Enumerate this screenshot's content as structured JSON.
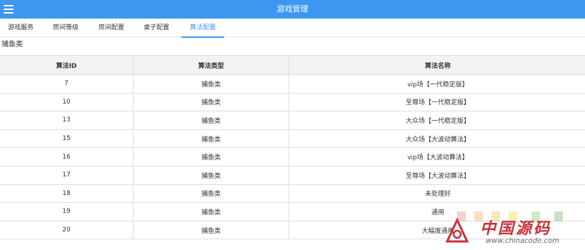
{
  "header": {
    "title": "游戏管理",
    "menu_icon": "hamburger-menu-icon",
    "background": "#3d97f0"
  },
  "tabs": [
    {
      "label": "游戏服务",
      "active": false
    },
    {
      "label": "房间等级",
      "active": false
    },
    {
      "label": "房间配置",
      "active": false
    },
    {
      "label": "桌子配置",
      "active": false
    },
    {
      "label": "算法配置",
      "active": true
    }
  ],
  "category_label": "捕鱼类",
  "table": {
    "columns": [
      "算法ID",
      "算法类型",
      "算法名称"
    ],
    "rows": [
      [
        "7",
        "捕鱼类",
        "vip场【一代稳定版】"
      ],
      [
        "10",
        "捕鱼类",
        "至尊场【一代稳定版】"
      ],
      [
        "13",
        "捕鱼类",
        "大众场【一代稳定版】"
      ],
      [
        "15",
        "捕鱼类",
        "大众场【大波动算法】"
      ],
      [
        "16",
        "捕鱼类",
        "vip场【大波动算法】"
      ],
      [
        "17",
        "捕鱼类",
        "至尊场【大波动算法】"
      ],
      [
        "18",
        "捕鱼类",
        "未处理好"
      ],
      [
        "19",
        "捕鱼类",
        "通用"
      ],
      [
        "20",
        "捕鱼类",
        "大幅度通用"
      ]
    ]
  },
  "watermark": {
    "text": "中国源码",
    "url": "www.chinacode.com",
    "accent": "#c83236"
  }
}
